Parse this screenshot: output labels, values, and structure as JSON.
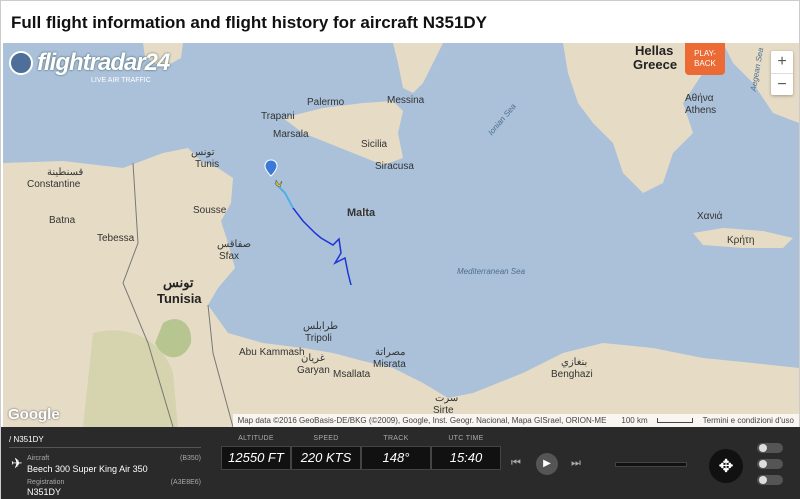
{
  "page": {
    "title": "Full flight information and flight history for aircraft N351DY"
  },
  "map": {
    "brand": {
      "name": "flightradar24",
      "sub": "LIVE AIR TRAFFIC"
    },
    "playback_label": "PLAY-BACK",
    "zoom_in": "+",
    "zoom_out": "−",
    "labels": {
      "hellas": "Hellas",
      "greece": "Greece",
      "palermo": "Palermo",
      "messina": "Messina",
      "trapani": "Trapani",
      "marsala": "Marsala",
      "sicilia": "Sicilia",
      "siracusa": "Siracusa",
      "malta": "Malta",
      "tunis_ar": "تونس",
      "tunis": "Tunis",
      "sousse": "Sousse",
      "sfax_ar": "صفاقس",
      "sfax": "Sfax",
      "tunisia_ar": "تونس",
      "tunisia": "Tunisia",
      "constantine_ar": "قسنطينة",
      "constantine": "Constantine",
      "batna": "Batna",
      "tebessa": "Tebessa",
      "tripoli_ar": "طرابلس",
      "tripoli": "Tripoli",
      "abu_kammash": "Abu Kammash",
      "garyan_ar": "غريان",
      "garyan": "Garyan",
      "misrata_ar": "مصراتة",
      "misrata": "Misrata",
      "msallata": "Msallata",
      "sirte_ar": "سرت",
      "sirte": "Sirte",
      "benghazi_ar": "بنغازي",
      "benghazi": "Benghazi",
      "athens_gr": "Αθήνα",
      "athens": "Athens",
      "crete_gr": "Χανιά",
      "crete": "Κρήτη",
      "ionian_sea": "Ionian Sea",
      "med_sea": "Mediterranean Sea",
      "aegean": "Aegean Sea"
    },
    "google": "Google",
    "attribution": "Map data ©2016 GeoBasis-DE/BKG (©2009), Google, Inst. Geogr. Nacional, Mapa GISrael, ORION-ME",
    "scale": "100 km",
    "terms": "Termini e condizioni d'uso"
  },
  "flight": {
    "id": "/ N351DY",
    "aircraft_label": "Aircraft",
    "aircraft": "Beech 300 Super King Air 350",
    "aircraft_code": "(B350)",
    "registration_label": "Registration",
    "registration": "N351DY",
    "registration_code": "(A3E8E6)"
  },
  "telemetry": {
    "altitude_label": "ALTITUDE",
    "altitude": "12550 FT",
    "speed_label": "SPEED",
    "speed": "220 KTS",
    "track_label": "TRACK",
    "track": "148°",
    "time_label": "UTC TIME",
    "time": "15:40"
  },
  "colors": {
    "sea": "#aac1d9",
    "land": "#e6dcc6",
    "track": "#1d35d6",
    "playback": "#ec6a34"
  }
}
